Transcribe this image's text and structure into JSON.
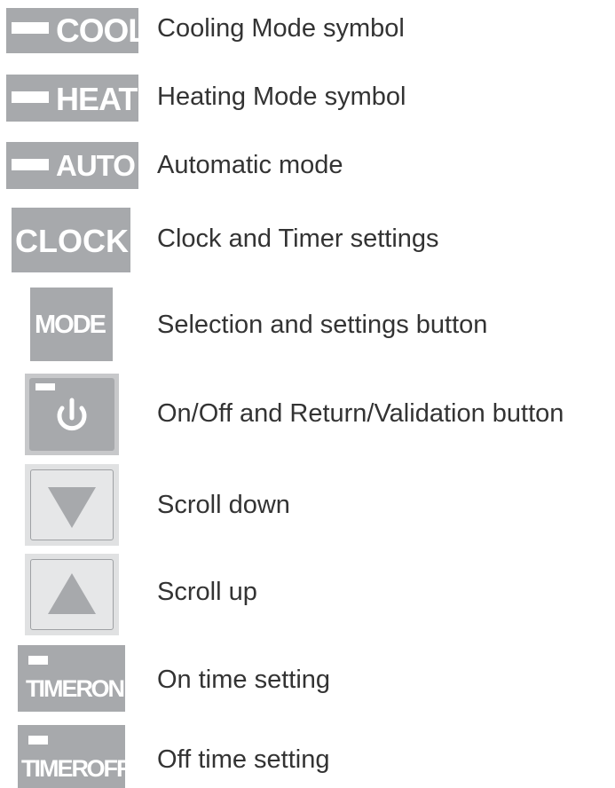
{
  "items": [
    {
      "symbol": "COOL",
      "description": "Cooling Mode symbol"
    },
    {
      "symbol": "HEAT",
      "description": "Heating Mode symbol"
    },
    {
      "symbol": "AUTO",
      "description": "Automatic mode"
    },
    {
      "symbol": "CLOCK",
      "description": "Clock and Timer settings"
    },
    {
      "symbol": "MODE",
      "description": "Selection and settings button"
    },
    {
      "symbol": "",
      "description": "On/Off and Return/Validation button",
      "icon": "power-icon"
    },
    {
      "symbol": "",
      "description": "Scroll down",
      "icon": "triangle-down-icon"
    },
    {
      "symbol": "",
      "description": "Scroll up",
      "icon": "triangle-up-icon"
    },
    {
      "symbol": "TIMER ON",
      "description": "On time setting"
    },
    {
      "symbol": "TIMER OFF",
      "description": "Off time setting"
    }
  ],
  "colors": {
    "symbol_gray": "#a7a9ac",
    "text": "#333333",
    "scroll_bg": "#e0e1e2",
    "triangle": "#a7a9ac"
  }
}
